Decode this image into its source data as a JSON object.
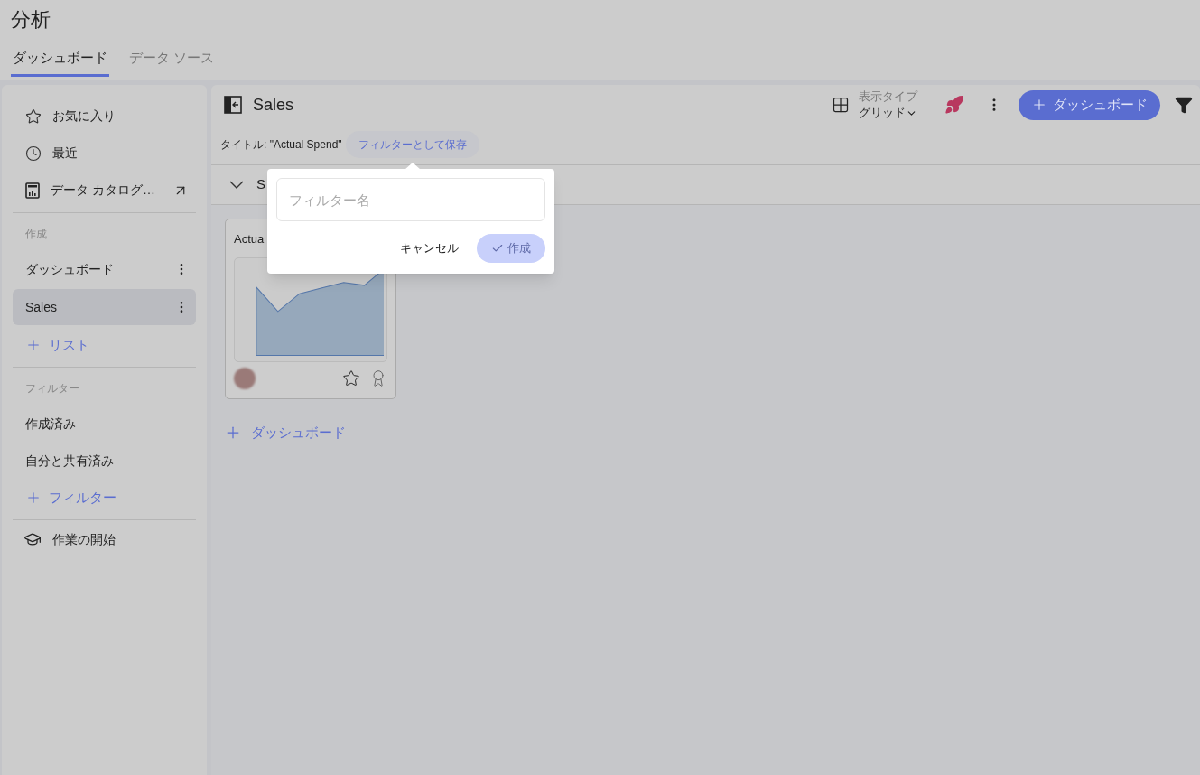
{
  "app": {
    "title": "分析"
  },
  "tabs": [
    {
      "label": "ダッシュボード",
      "selected": true
    },
    {
      "label": "データ ソース",
      "selected": false
    }
  ],
  "sidebar": {
    "nav": [
      {
        "kind": "favorites",
        "label": "お気に入り",
        "external": false
      },
      {
        "kind": "recent",
        "label": "最近",
        "external": false
      },
      {
        "kind": "catalog",
        "label": "データ カタログ…",
        "external": true
      }
    ],
    "create": {
      "heading": "作成",
      "items": [
        {
          "label": "ダッシュボード",
          "selected": false
        },
        {
          "label": "Sales",
          "selected": true
        }
      ],
      "add": "リスト"
    },
    "filters": {
      "heading": "フィルター",
      "items": [
        {
          "label": "作成済み"
        },
        {
          "label": "自分と共有済み"
        }
      ],
      "add": "フィルター"
    },
    "footer": {
      "label": "作業の開始"
    }
  },
  "main": {
    "title": "Sales",
    "view_type": {
      "label": "表示タイプ",
      "value": "グリッド"
    },
    "add_button": "ダッシュボード",
    "filter_chip": "タイトル: \"Actual Spend\"",
    "save_filter": "フィルターとして保存",
    "section": {
      "title": "S",
      "expanded": true
    },
    "cards": [
      {
        "title": "Actua",
        "favorite": false
      }
    ],
    "add_dashboard": "ダッシュボード"
  },
  "popover": {
    "placeholder": "フィルター名",
    "cancel": "キャンセル",
    "create": "作成",
    "create_disabled": true
  }
}
